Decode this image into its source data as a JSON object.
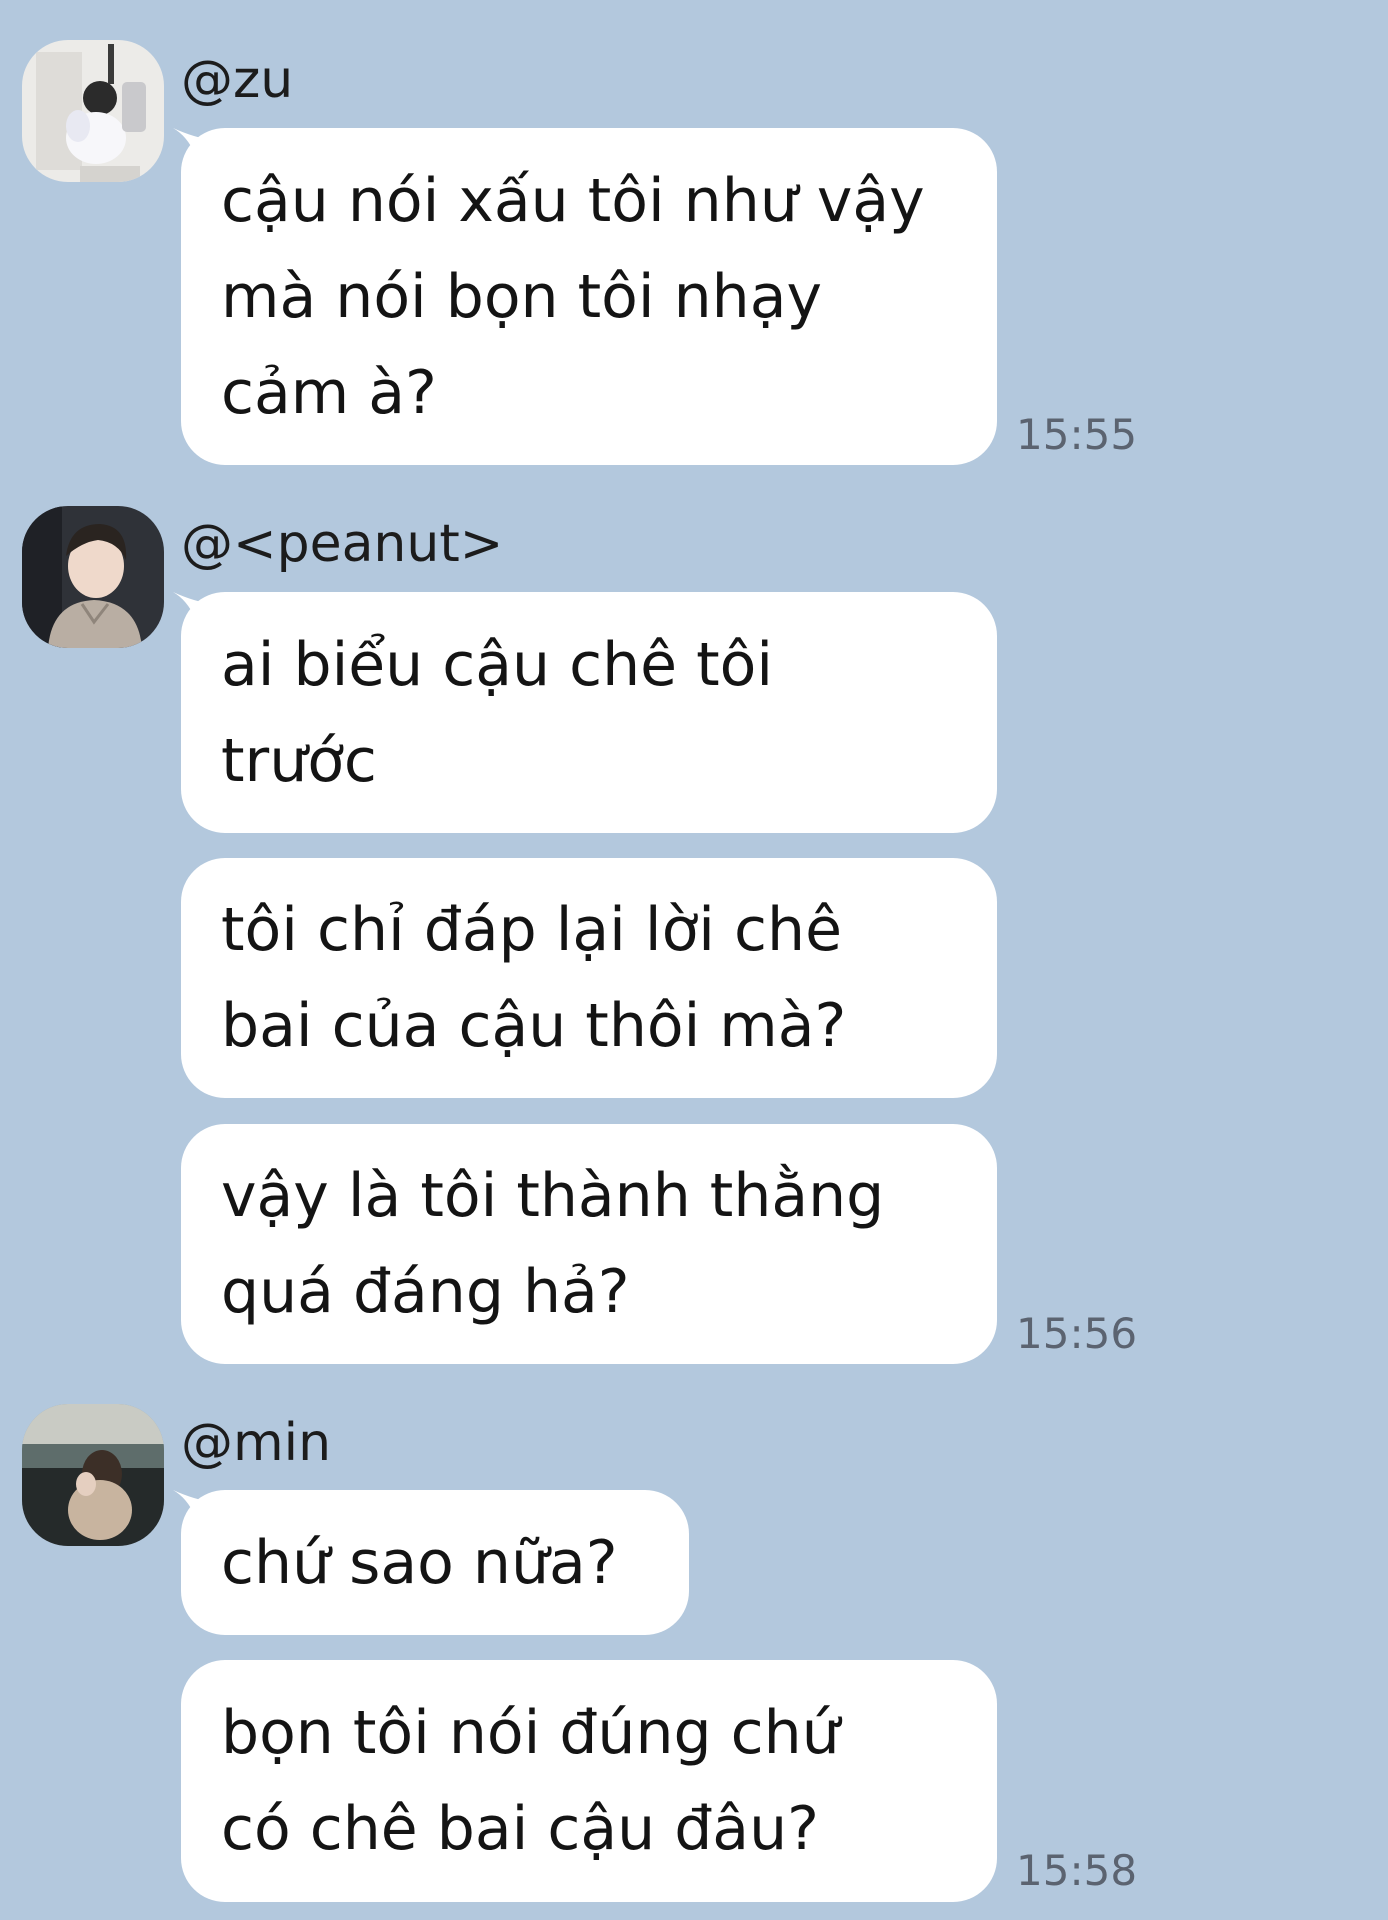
{
  "messages": [
    {
      "sender": "@zu",
      "avatar_icon": "profile-photo-mirror-selfie",
      "bubbles": [
        {
          "lines": [
            "cậu nói xấu tôi như vậy",
            "mà nói bọn tôi nhạy",
            "cảm à?"
          ]
        }
      ],
      "time": "15:55"
    },
    {
      "sender": "@<peanut>",
      "avatar_icon": "profile-photo-boy-hoodie",
      "bubbles": [
        {
          "lines": [
            "ai biểu cậu chê tôi",
            "trước"
          ]
        },
        {
          "lines": [
            "tôi chỉ đáp lại lời chê",
            "bai của cậu thôi mà?"
          ]
        },
        {
          "lines": [
            "vậy là tôi thành thằng",
            "quá đáng hả?"
          ]
        }
      ],
      "time": "15:56"
    },
    {
      "sender": "@min",
      "avatar_icon": "profile-photo-girl-sunset",
      "bubbles": [
        {
          "lines": [
            "chứ sao nữa?"
          ]
        },
        {
          "lines": [
            "bọn tôi nói đúng chứ",
            "có chê bai cậu đâu?"
          ]
        }
      ],
      "time": "15:58"
    }
  ],
  "colors": {
    "background": "#b3c8dd",
    "bubble": "#ffffff",
    "text": "#141414",
    "timestamp": "#5b6370"
  }
}
